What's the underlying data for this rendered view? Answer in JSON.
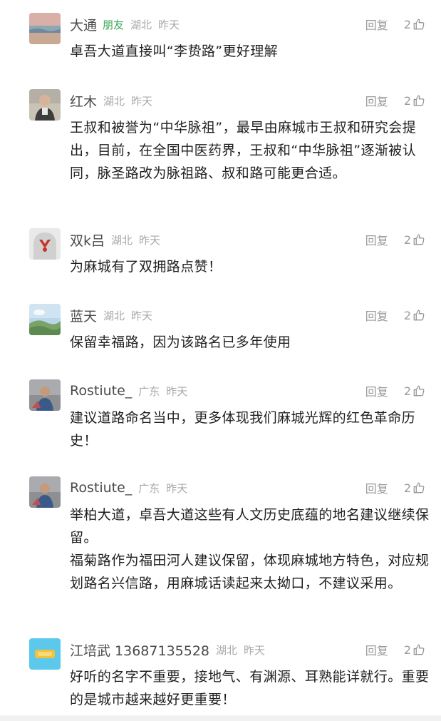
{
  "comments": [
    {
      "name": "大通",
      "tag": "朋友",
      "location": "湖北",
      "time": "昨天",
      "reply_label": "回复",
      "likes": "2",
      "text": [
        "卓吾大道直接叫“李贽路”更好理解"
      ]
    },
    {
      "name": "红木",
      "tag": "",
      "location": "湖北",
      "time": "昨天",
      "reply_label": "回复",
      "likes": "2",
      "text": [
        "王叔和被誉为“中华脉祖”，最早由麻城市王叔和研究会提出，目前，在全国中医药界，王叔和“中华脉祖”逐渐被认同，脉圣路改为脉祖路、叔和路可能更合适。"
      ]
    },
    {
      "name": "双k吕",
      "tag": "",
      "location": "湖北",
      "time": "昨天",
      "reply_label": "回复",
      "likes": "2",
      "text": [
        "为麻城有了双拥路点赞！"
      ]
    },
    {
      "name": "蓝天",
      "tag": "",
      "location": "湖北",
      "time": "昨天",
      "reply_label": "回复",
      "likes": "2",
      "text": [
        "保留幸福路，因为该路名已多年使用"
      ]
    },
    {
      "name": "Rostiute_",
      "tag": "",
      "location": "广东",
      "time": "昨天",
      "reply_label": "回复",
      "likes": "2",
      "text": [
        "建议道路命名当中，更多体现我们麻城光辉的红色革命历史！"
      ]
    },
    {
      "name": "Rostiute_",
      "tag": "",
      "location": "广东",
      "time": "昨天",
      "reply_label": "回复",
      "likes": "2",
      "text": [
        "举柏大道，卓吾大道这些有人文历史底蕴的地名建议继续保留。",
        "福菊路作为福田河人建议保留，体现麻城地方特色，对应规划路名兴信路，用麻城话读起来太拗口，不建议采用。"
      ]
    },
    {
      "name": "江培武 13687135528",
      "tag": "",
      "location": "湖北",
      "time": "昨天",
      "reply_label": "回复",
      "likes": "2",
      "text": [
        "好听的名字不重要，接地气、有渊源、耳熟能详就行。重要的是城市越来越好更重要！"
      ]
    }
  ],
  "icons": {
    "like": "thumbs-up-icon"
  }
}
